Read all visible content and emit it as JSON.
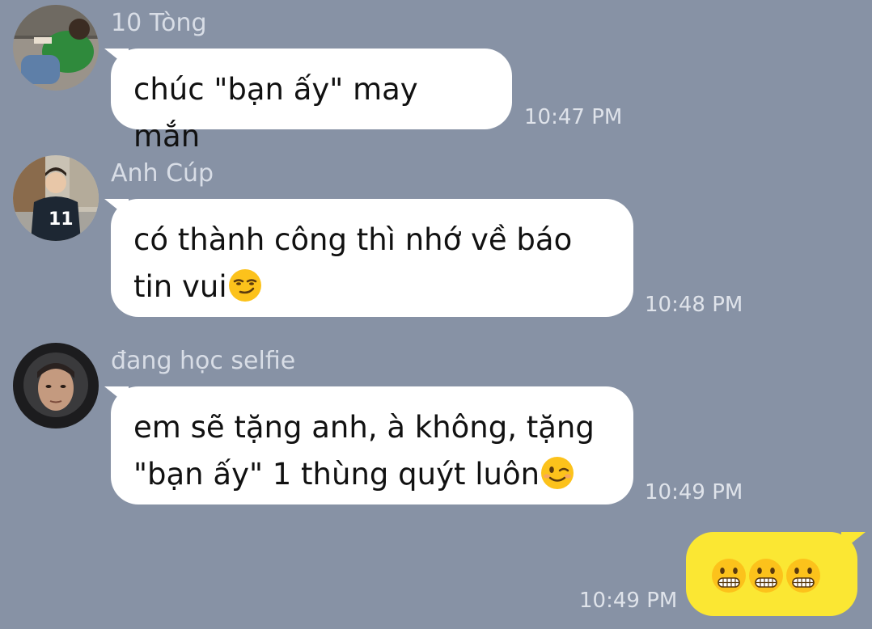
{
  "messages": [
    {
      "sender": "10 Tòng",
      "avatar_icon": "avatar-photo-green-sweater",
      "text": "chúc \"bạn ấy\" may mắn",
      "time": "10:47 PM"
    },
    {
      "sender": "Anh Cúp",
      "avatar_icon": "avatar-photo-jersey-11",
      "line1": "có thành công thì nhớ về báo",
      "line2": "tin vui",
      "emoji": "smirking-face-emoji",
      "time": "10:48 PM"
    },
    {
      "sender": "đang học selfie",
      "avatar_icon": "avatar-photo-hood",
      "line1": "em sẽ tặng anh, à không, tặng",
      "line2": "\"bạn ấy\" 1 thùng quýt luôn",
      "emoji": "winking-face-emoji",
      "time": "10:49 PM"
    },
    {
      "outgoing": true,
      "emojis": [
        "grimacing-face-emoji",
        "grimacing-face-emoji",
        "grimacing-face-emoji"
      ],
      "time": "10:49 PM"
    }
  ],
  "colors": {
    "background": "#8792a5",
    "incoming_bubble": "#ffffff",
    "outgoing_bubble": "#fbe733",
    "meta_text": "#dfe3ea"
  }
}
